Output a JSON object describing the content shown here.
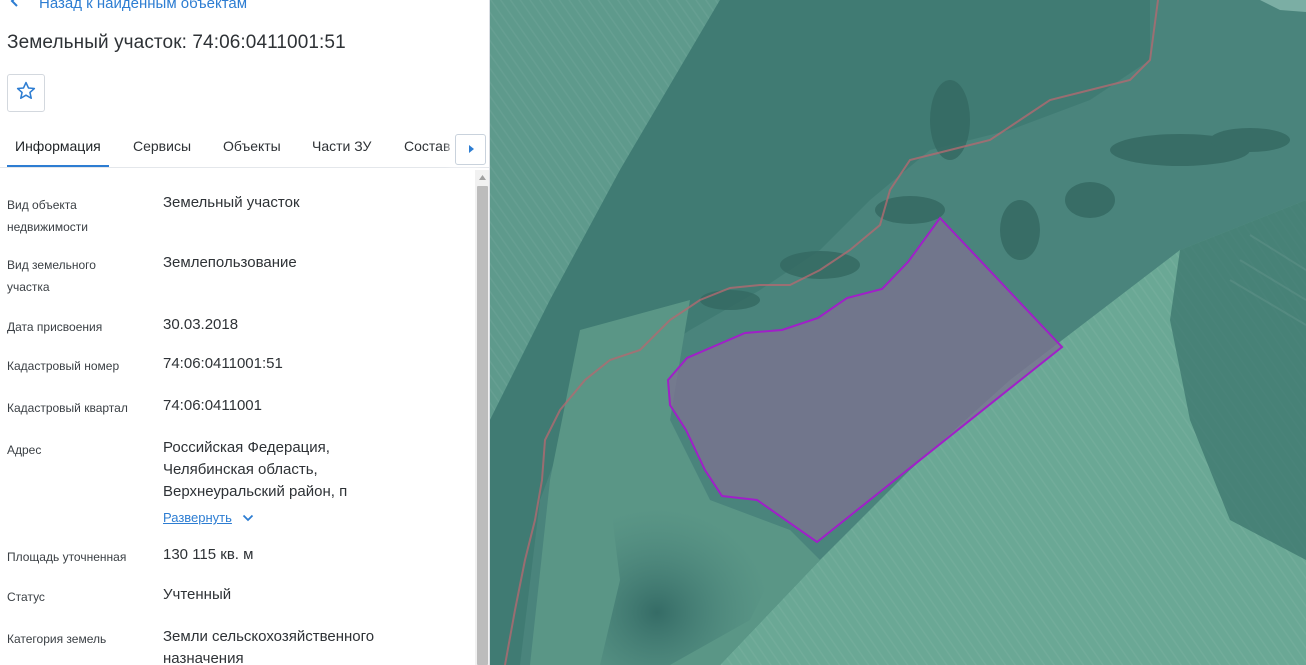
{
  "panel": {
    "back_link": "Назад к найденным объектам",
    "title": "Земельный участок: 74:06:0411001:51",
    "favorite_icon": "star-outline-icon",
    "tabs": [
      {
        "label": "Информация",
        "active": true
      },
      {
        "label": "Сервисы",
        "active": false
      },
      {
        "label": "Объекты",
        "active": false
      },
      {
        "label": "Части ЗУ",
        "active": false
      },
      {
        "label": "Состав",
        "active": false
      }
    ],
    "tab_scroll_icon": "caret-right-icon",
    "info": {
      "object_type": {
        "label_1": "Вид объекта",
        "label_2": "недвижимости",
        "value": "Земельный участок"
      },
      "land_type": {
        "label_1": "Вид земельного",
        "label_2": "участка",
        "value": "Землепользование"
      },
      "assign_date": {
        "label": "Дата присвоения",
        "value": "30.03.2018"
      },
      "cadastral_number": {
        "label": "Кадастровый номер",
        "value": "74:06:0411001:51"
      },
      "cadastral_quarter": {
        "label": "Кадастровый квартал",
        "value": "74:06:0411001"
      },
      "address": {
        "label": "Адрес",
        "line_1": "Российская Федерация,",
        "line_2": "Челябинская область,",
        "line_3": "Верхнеуральский район, п",
        "expand_label": "Развернуть"
      },
      "area": {
        "label": "Площадь уточненная",
        "value": "130 115 кв. м"
      },
      "status": {
        "label": "Статус",
        "value": "Учтенный"
      },
      "land_category": {
        "label": "Категория земель",
        "line_1": "Земли сельскохозяйственного",
        "line_2": "назначения"
      }
    }
  },
  "colors": {
    "accent": "#2d7dd2",
    "parcel_outline": "#a020c8",
    "parcel_fill": "#7b7390"
  }
}
